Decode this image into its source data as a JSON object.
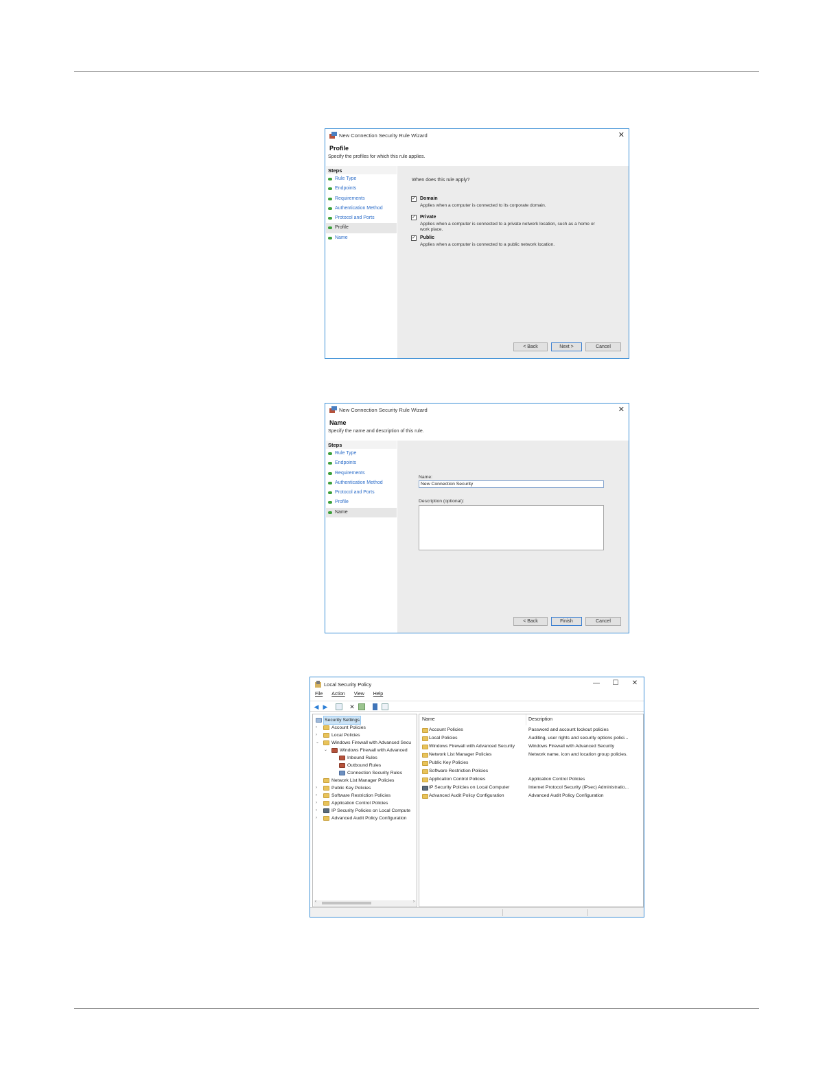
{
  "wizard_profile": {
    "title": "New Connection Security Rule Wizard",
    "close": "✕",
    "page_heading": "Profile",
    "page_subtitle": "Specify the profiles for which this rule applies.",
    "steps_heading": "Steps",
    "steps": [
      "Rule Type",
      "Endpoints",
      "Requirements",
      "Authentication Method",
      "Protocol and Ports",
      "Profile",
      "Name"
    ],
    "question": "When does this rule apply?",
    "options": [
      {
        "label": "Domain",
        "desc": "Applies when a computer is connected to its corporate domain.",
        "checked": true
      },
      {
        "label": "Private",
        "desc": "Applies when a computer is connected to a private network location, such as a home or work place.",
        "checked": true
      },
      {
        "label": "Public",
        "desc": "Applies when a computer is connected to a public network location.",
        "checked": true
      }
    ],
    "buttons": {
      "back": "< Back",
      "next": "Next >",
      "cancel": "Cancel"
    }
  },
  "wizard_name": {
    "title": "New Connection Security Rule Wizard",
    "close": "✕",
    "page_heading": "Name",
    "page_subtitle": "Specify the name and description of this rule.",
    "steps_heading": "Steps",
    "steps": [
      "Rule Type",
      "Endpoints",
      "Requirements",
      "Authentication Method",
      "Protocol and Ports",
      "Profile",
      "Name"
    ],
    "name_label": "Name:",
    "name_value": "New Connection Security",
    "description_label": "Description (optional):",
    "description_value": "",
    "buttons": {
      "back": "< Back",
      "finish": "Finish",
      "cancel": "Cancel"
    }
  },
  "local_security_policy": {
    "title": "Local Security Policy",
    "window_buttons": {
      "minimize": "—",
      "maximize": "☐",
      "close": "✕"
    },
    "menu": [
      "File",
      "Action",
      "View",
      "Help"
    ],
    "tree": [
      {
        "label": "Security Settings",
        "arrow": "",
        "selected": true
      },
      {
        "label": "Account Policies",
        "arrow": "›"
      },
      {
        "label": "Local Policies",
        "arrow": "›"
      },
      {
        "label": "Windows Firewall with Advanced Secu",
        "arrow": "⌄"
      },
      {
        "label": "Windows Firewall with Advanced",
        "arrow": "⌄"
      },
      {
        "label": "Inbound Rules",
        "arrow": ""
      },
      {
        "label": "Outbound Rules",
        "arrow": ""
      },
      {
        "label": "Connection Security Rules",
        "arrow": ""
      },
      {
        "label": "Network List Manager Policies",
        "arrow": ""
      },
      {
        "label": "Public Key Policies",
        "arrow": "›"
      },
      {
        "label": "Software Restriction Policies",
        "arrow": "›"
      },
      {
        "label": "Application Control Policies",
        "arrow": "›"
      },
      {
        "label": "IP Security Policies on Local Compute",
        "arrow": "›"
      },
      {
        "label": "Advanced Audit Policy Configuration",
        "arrow": "›"
      }
    ],
    "scroll": {
      "left": "‹",
      "right": "›"
    },
    "columns": {
      "name": "Name",
      "description": "Description"
    },
    "rows": [
      {
        "name": "Account Policies",
        "description": "Password and account lockout policies"
      },
      {
        "name": "Local Policies",
        "description": "Auditing, user rights and security options polici..."
      },
      {
        "name": "Windows Firewall with Advanced Security",
        "description": "Windows Firewall with Advanced Security"
      },
      {
        "name": "Network List Manager Policies",
        "description": "Network name, icon and location group policies."
      },
      {
        "name": "Public Key Policies",
        "description": ""
      },
      {
        "name": "Software Restriction Policies",
        "description": ""
      },
      {
        "name": "Application Control Policies",
        "description": "Application Control Policies"
      },
      {
        "name": "IP Security Policies on Local Computer",
        "description": "Internet Protocol Security (IPsec) Administratio..."
      },
      {
        "name": "Advanced Audit Policy Configuration",
        "description": "Advanced Audit Policy Configuration"
      }
    ]
  }
}
